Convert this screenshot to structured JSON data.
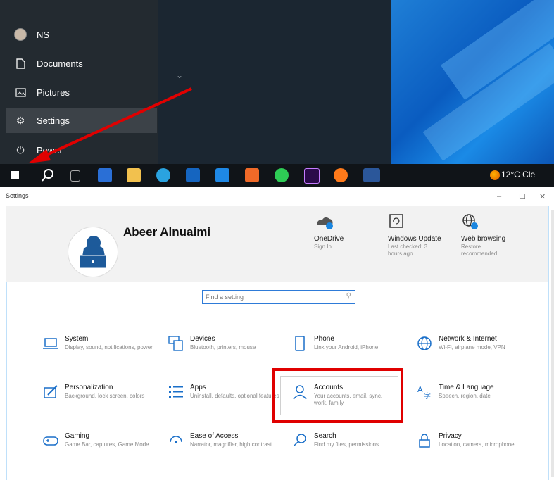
{
  "start_menu": {
    "items": [
      {
        "label": "NS",
        "icon": "user-avatar-icon"
      },
      {
        "label": "Documents",
        "icon": "document-icon"
      },
      {
        "label": "Pictures",
        "icon": "pictures-icon"
      },
      {
        "label": "Settings",
        "icon": "gear-icon"
      },
      {
        "label": "Power",
        "icon": "power-icon"
      }
    ]
  },
  "taskbar": {
    "weather_temp": "12°C Cle",
    "apps": [
      "windows-start-icon",
      "search-icon",
      "task-view-icon",
      "store-icon",
      "file-explorer-icon",
      "telegram-icon",
      "outlook-icon",
      "vscode-icon",
      "xampp-icon",
      "whatsapp-icon",
      "photoshop-icon",
      "firefox-icon",
      "word-icon"
    ]
  },
  "settings": {
    "window_title": "Settings",
    "window_controls": {
      "minimize": "–",
      "maximize": "☐",
      "close": "✕"
    },
    "user": {
      "name": "Abeer Alnuaimi"
    },
    "hero": [
      {
        "title": "OneDrive",
        "sub": "Sign In"
      },
      {
        "title": "Windows Update",
        "sub": "Last checked: 3 hours ago"
      },
      {
        "title": "Web browsing",
        "sub": "Restore recommended"
      }
    ],
    "search": {
      "placeholder": "Find a setting"
    },
    "tiles": [
      {
        "title": "System",
        "sub": "Display, sound, notifications, power"
      },
      {
        "title": "Devices",
        "sub": "Bluetooth, printers, mouse"
      },
      {
        "title": "Phone",
        "sub": "Link your Android, iPhone"
      },
      {
        "title": "Network & Internet",
        "sub": "Wi-Fi, airplane mode, VPN"
      },
      {
        "title": "Personalization",
        "sub": "Background, lock screen, colors"
      },
      {
        "title": "Apps",
        "sub": "Uninstall, defaults, optional features"
      },
      {
        "title": "Accounts",
        "sub": "Your accounts, email, sync, work, family"
      },
      {
        "title": "Time & Language",
        "sub": "Speech, region, date"
      },
      {
        "title": "Gaming",
        "sub": "Game Bar, captures, Game Mode"
      },
      {
        "title": "Ease of Access",
        "sub": "Narrator, magnifier, high contrast"
      },
      {
        "title": "Search",
        "sub": "Find my files, permissions"
      },
      {
        "title": "Privacy",
        "sub": "Location, camera, microphone"
      }
    ]
  },
  "colors": {
    "accent": "#0078d7",
    "annotation": "#e00000"
  }
}
